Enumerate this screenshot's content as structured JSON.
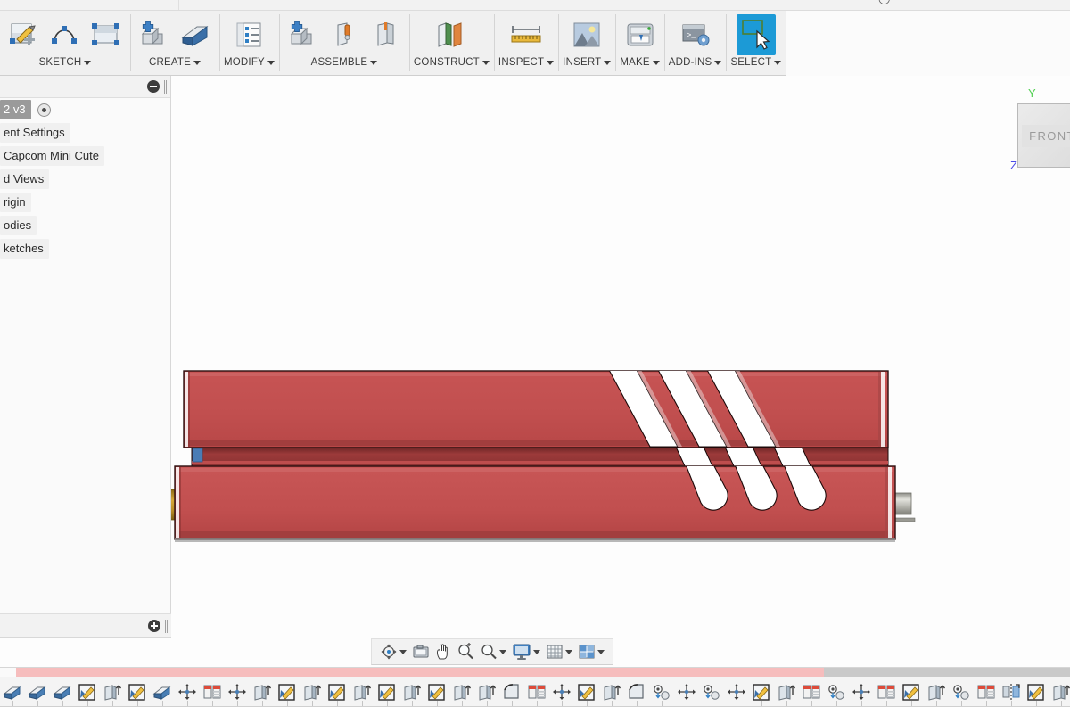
{
  "window": {
    "title_strip_items": [
      "",
      "",
      ""
    ]
  },
  "ribbon": {
    "groups": [
      {
        "name": "sketch",
        "label": "SKETCH",
        "has_caret": true,
        "buttons": [
          {
            "name": "create-sketch-icon",
            "tip": "Create Sketch"
          },
          {
            "name": "sketch-spline-icon",
            "tip": "Spline"
          },
          {
            "name": "sketch-rectangle-icon",
            "tip": "Rectangle"
          }
        ]
      },
      {
        "name": "create",
        "label": "CREATE",
        "has_caret": true,
        "buttons": [
          {
            "name": "new-component-icon",
            "tip": "New Component"
          },
          {
            "name": "extrude-icon",
            "tip": "Extrude"
          }
        ]
      },
      {
        "name": "modify",
        "label": "MODIFY",
        "has_caret": true,
        "buttons": [
          {
            "name": "modify-properties-icon",
            "tip": "Change Parameters"
          }
        ]
      },
      {
        "name": "assemble",
        "label": "ASSEMBLE",
        "has_caret": true,
        "buttons": [
          {
            "name": "new-component-assemble-icon",
            "tip": "New Component"
          },
          {
            "name": "joint-icon",
            "tip": "Joint"
          },
          {
            "name": "as-built-joint-icon",
            "tip": "As-built Joint"
          }
        ]
      },
      {
        "name": "construct",
        "label": "CONSTRUCT",
        "has_caret": true,
        "buttons": [
          {
            "name": "offset-plane-icon",
            "tip": "Offset Plane"
          }
        ]
      },
      {
        "name": "inspect",
        "label": "INSPECT",
        "has_caret": true,
        "buttons": [
          {
            "name": "measure-icon",
            "tip": "Measure"
          }
        ]
      },
      {
        "name": "insert",
        "label": "INSERT",
        "has_caret": true,
        "buttons": [
          {
            "name": "insert-image-icon",
            "tip": "Canvas"
          }
        ]
      },
      {
        "name": "make",
        "label": "MAKE",
        "has_caret": true,
        "buttons": [
          {
            "name": "3d-print-icon",
            "tip": "3D Print"
          }
        ]
      },
      {
        "name": "add-ins",
        "label": "ADD-INS",
        "has_caret": true,
        "buttons": [
          {
            "name": "scripts-and-addins-icon",
            "tip": "Scripts and Add-Ins"
          }
        ]
      },
      {
        "name": "select",
        "label": "SELECT",
        "has_caret": true,
        "active": true,
        "buttons": [
          {
            "name": "select-tool-icon",
            "tip": "Select"
          }
        ]
      }
    ]
  },
  "browser": {
    "header": {
      "collapse_icon": "minus-circle-icon",
      "grip_icon": "panel-grip-icon"
    },
    "footer": {
      "expand_icon": "plus-circle-icon",
      "grip_icon": "panel-grip-icon"
    },
    "tree": [
      {
        "label": "2 v3",
        "selected": true,
        "has_eye": true
      },
      {
        "label": "ent Settings",
        "selected": false,
        "has_eye": false
      },
      {
        "label": "Capcom Mini Cute",
        "selected": false,
        "has_eye": false
      },
      {
        "label": "d Views",
        "selected": false,
        "has_eye": false
      },
      {
        "label": "rigin",
        "selected": false,
        "has_eye": false
      },
      {
        "label": "odies",
        "selected": false,
        "has_eye": false
      },
      {
        "label": "ketches",
        "selected": false,
        "has_eye": false
      }
    ]
  },
  "viewcube": {
    "face_label": "FRONT",
    "axis_y_label": "Y",
    "axis_z_label": "Z",
    "axis_y_color": "#52d152",
    "axis_z_color": "#4a4ae6"
  },
  "navbar": {
    "items": [
      {
        "name": "orbit-icon",
        "label": "Orbit",
        "caret": true
      },
      {
        "name": "look-at-icon",
        "label": "Look At",
        "caret": false
      },
      {
        "name": "pan-icon",
        "label": "Pan",
        "caret": false
      },
      {
        "name": "zoom-icon",
        "label": "Zoom",
        "caret": false
      },
      {
        "name": "fit-icon",
        "label": "Fit",
        "caret": true
      },
      {
        "name": "display-settings-icon",
        "label": "Display Settings",
        "caret": true
      },
      {
        "name": "grid-snaps-icon",
        "label": "Grid and Snaps",
        "caret": true
      },
      {
        "name": "viewports-icon",
        "label": "Viewports",
        "caret": true
      }
    ]
  },
  "timeline": {
    "progress_percent": 77,
    "features": [
      {
        "name": "extrude-feature",
        "icon": "extrude"
      },
      {
        "name": "extrude-feature",
        "icon": "extrude"
      },
      {
        "name": "extrude-feature",
        "icon": "extrude"
      },
      {
        "name": "sketch-feature",
        "icon": "sketch"
      },
      {
        "name": "extrude-feature",
        "icon": "extrude-up"
      },
      {
        "name": "sketch-feature",
        "icon": "sketch"
      },
      {
        "name": "extrude-feature",
        "icon": "extrude"
      },
      {
        "name": "move-feature",
        "icon": "move"
      },
      {
        "name": "appearance-feature",
        "icon": "appearance"
      },
      {
        "name": "move-feature",
        "icon": "move"
      },
      {
        "name": "extrude-feature",
        "icon": "extrude-up"
      },
      {
        "name": "sketch-feature",
        "icon": "sketch"
      },
      {
        "name": "extrude-feature",
        "icon": "extrude-up"
      },
      {
        "name": "sketch-feature",
        "icon": "sketch"
      },
      {
        "name": "extrude-feature",
        "icon": "extrude-up"
      },
      {
        "name": "sketch-feature",
        "icon": "sketch"
      },
      {
        "name": "extrude-feature",
        "icon": "extrude-up"
      },
      {
        "name": "sketch-feature",
        "icon": "sketch"
      },
      {
        "name": "extrude-feature",
        "icon": "extrude-up"
      },
      {
        "name": "extrude-feature",
        "icon": "extrude-up"
      },
      {
        "name": "fillet-feature",
        "icon": "fillet"
      },
      {
        "name": "appearance-feature",
        "icon": "appearance"
      },
      {
        "name": "move-feature",
        "icon": "move"
      },
      {
        "name": "sketch-feature",
        "icon": "sketch"
      },
      {
        "name": "extrude-feature",
        "icon": "extrude-up"
      },
      {
        "name": "fillet-feature",
        "icon": "fillet"
      },
      {
        "name": "hole-feature",
        "icon": "hole"
      },
      {
        "name": "move-feature",
        "icon": "move"
      },
      {
        "name": "hole-feature",
        "icon": "hole"
      },
      {
        "name": "move-feature",
        "icon": "move"
      },
      {
        "name": "sketch-feature",
        "icon": "sketch"
      },
      {
        "name": "extrude-feature",
        "icon": "extrude-up"
      },
      {
        "name": "appearance-feature",
        "icon": "appearance"
      },
      {
        "name": "hole-feature",
        "icon": "hole"
      },
      {
        "name": "move-feature",
        "icon": "move"
      },
      {
        "name": "appearance-feature",
        "icon": "appearance"
      },
      {
        "name": "sketch-feature",
        "icon": "sketch"
      },
      {
        "name": "extrude-feature",
        "icon": "extrude-up"
      },
      {
        "name": "hole-feature",
        "icon": "hole"
      },
      {
        "name": "appearance-feature",
        "icon": "appearance"
      },
      {
        "name": "mirror-feature",
        "icon": "mirror"
      },
      {
        "name": "sketch-feature",
        "icon": "sketch"
      },
      {
        "name": "extrude-feature",
        "icon": "extrude-up"
      },
      {
        "name": "mirror-feature",
        "icon": "mirror"
      }
    ]
  },
  "model": {
    "name": "capcom-mini-cute-assembly",
    "body_color": "#c14f4f",
    "body_color_dark": "#8d3636",
    "slot_color": "#ffffff",
    "left_connector_color": "#c49a33",
    "right_connector_color": "#b9b9b0",
    "tab_color": "#4a7cb5",
    "slot_count": 3
  }
}
